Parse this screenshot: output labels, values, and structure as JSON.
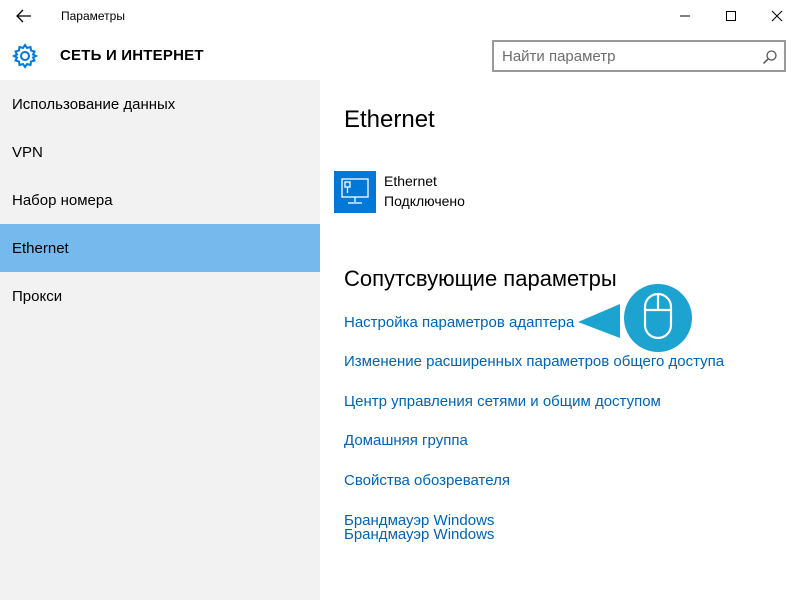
{
  "window": {
    "title": "Параметры"
  },
  "header": {
    "title": "СЕТЬ И ИНТЕРНЕТ",
    "search_placeholder": "Найти параметр"
  },
  "sidebar": {
    "items": [
      {
        "label": "Использование данных",
        "active": false
      },
      {
        "label": "VPN",
        "active": false
      },
      {
        "label": "Набор номера",
        "active": false
      },
      {
        "label": "Ethernet",
        "active": true
      },
      {
        "label": "Прокси",
        "active": false
      }
    ]
  },
  "main": {
    "title": "Ethernet",
    "connection": {
      "name": "Ethernet",
      "status": "Подключено",
      "icon": "ethernet-monitor-icon"
    },
    "related_title": "Сопутсвующие параметры",
    "links": [
      "Настройка параметров адаптера",
      "Изменение расширенных параметров общего доступа",
      "Центр управления сетями и общим доступом",
      "Домашняя группа",
      "Свойства обозревателя",
      "Брандмауэр Windows",
      "Брандмауэр Windows"
    ]
  },
  "colors": {
    "accent": "#0078d7",
    "link": "#0063b1",
    "selected": "#76b9ed",
    "callout": "#1ca3cf"
  }
}
